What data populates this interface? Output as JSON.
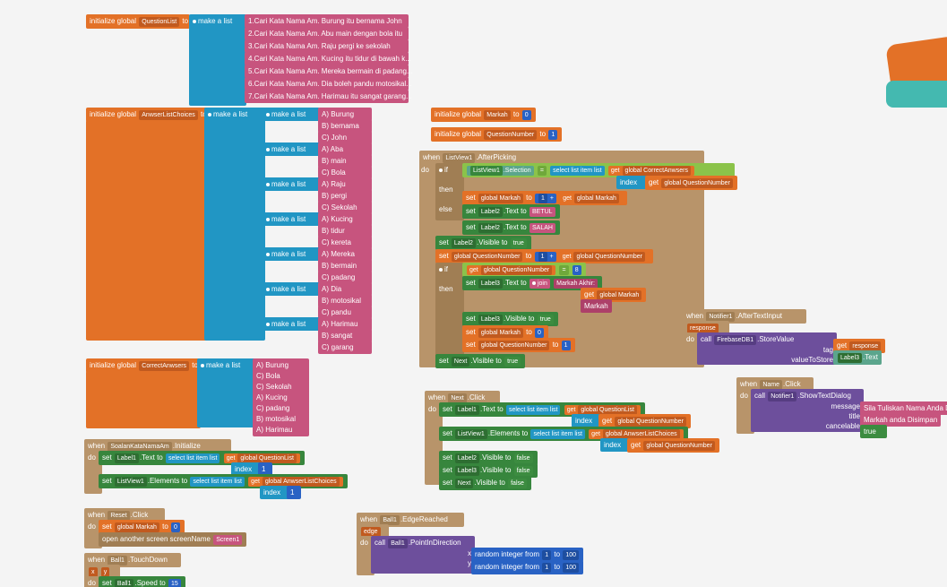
{
  "initQL": {
    "label": "initialize global",
    "var": "QuestionList",
    "to": "to",
    "make": "make a list"
  },
  "ql": [
    "1.Cari Kata Nama Am. Burung itu bernama John",
    "2.Cari Kata Nama Am. Abu main dengan bola itu",
    "3.Cari Kata Nama Am. Raju pergi ke sekolah",
    "4.Cari Kata Nama Am. Kucing itu tidur di bawah k...",
    "5.Cari Kata Nama Am. Mereka bermain di padang...",
    "6.Cari Kata Nama Am. Dia boleh pandu motosikal...",
    "7.Cari Kata Nama Am. Harimau itu sangat garang..."
  ],
  "initALC": {
    "label": "initialize global",
    "var": "AnwserListChoices",
    "to": "to"
  },
  "alc": [
    [
      "A) Burung",
      "B) bernama",
      "C) John",
      "A) Aba"
    ],
    [
      "B) main",
      "C) Bola",
      "A) Raju",
      "B) pergi"
    ],
    [
      "C) Sekolah",
      "A) Kucing",
      "B) tidur",
      "C) kereta"
    ],
    [
      "A) Mereka",
      "B) bermain",
      "C) padang",
      "A) Dia"
    ],
    [
      "B) motosikal",
      "C) pandu",
      "A) Harimau",
      "B) sangat",
      "C) garang"
    ]
  ],
  "initCA": {
    "label": "initialize global",
    "var": "CorrectAnwsers",
    "to": "to"
  },
  "ca": [
    "A) Burung",
    "C) Bola",
    "C) Sekolah",
    "A) Kucing",
    "C) padang",
    "B) motosikal",
    "A) Harimau"
  ],
  "initMarkah": {
    "label": "initialize global",
    "var": "Markah",
    "to": "to",
    "val": "0"
  },
  "initQN": {
    "label": "initialize global",
    "var": "QuestionNumber",
    "to": "to",
    "val": "1"
  },
  "afterPick": {
    "when": "when",
    "comp": "ListView1",
    "evt": ".AfterPicking",
    "do": "do"
  },
  "if": "if",
  "then": "then",
  "else": "else",
  "lvSel": {
    "a": "ListView1",
    "b": "Selection"
  },
  "eq": "=",
  "sli": {
    "a": "select list item  list",
    "b": "index"
  },
  "gca": "global CorrectAnwsers",
  "gqn": "global QuestionNumber",
  "gm": "global Markah",
  "gql": "global QuestionList",
  "galc": "global AnwserListChoices",
  "get": "get",
  "set": "set",
  "to": "to",
  "plus": "+",
  "lbl2": "Label2",
  "lbl3": "Label3",
  "lbl1": "Label1",
  "txt": ".Text",
  "vis": ".Visible",
  "elems": ".Elements",
  "betul": "BETUL",
  "salah": "SALAH",
  "true": "true",
  "false": "false",
  "join": "join",
  "makhir": "Markah Akhir:",
  "markah": "Markah",
  "one": "1",
  "zero": "0",
  "eight": "8",
  "nextBtn": "Next",
  "soalan": {
    "when": "when",
    "comp": "SoalanKataNamaAm",
    "evt": ".Initialize"
  },
  "nextClick": {
    "when": "when",
    "comp": "Next",
    "evt": ".Click"
  },
  "reset": {
    "when": "when",
    "comp": "Reset",
    "evt": ".Click",
    "open": "open another screen  screenName",
    "scr": "Screen1"
  },
  "ball": {
    "when": "when",
    "comp": "Ball1",
    "evt": ".TouchDown",
    "x": "x",
    "y": "y",
    "spd": ".Speed",
    "v": "15"
  },
  "edge": {
    "when": "when",
    "comp": "Ball1",
    "evt": ".EdgeReached",
    "edge": "edge",
    "pid": ".PointInDirection",
    "rnd": "random integer from",
    "to": "to",
    "a": "1",
    "b": "100"
  },
  "notifier1": {
    "when": "when",
    "comp": "Notifier1",
    "evt": ".AfterTextInput",
    "resp": "response"
  },
  "fb": {
    "call": "call",
    "comp": "FirebaseDB1",
    "m": ".StoreValue",
    "tag": "tag",
    "vts": "valueToStore"
  },
  "nameClick": {
    "when": "when",
    "comp": "Name",
    "evt": ".Click"
  },
  "showDlg": {
    "comp": "Notifier1",
    "m": ".ShowTextDialog",
    "msg": "message",
    "title_k": "title",
    "canc": "cancelable",
    "msg_v": "Sila Tuliskan Nama Anda Di Sini",
    "title_v": "Markah anda Disimpan"
  },
  "call": "call"
}
